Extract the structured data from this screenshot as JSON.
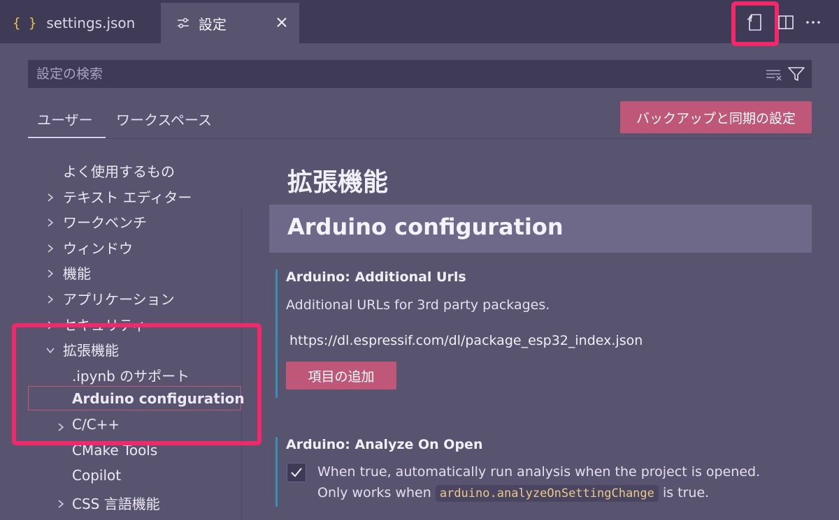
{
  "tabs": [
    {
      "label": "settings.json",
      "icon": "json-braces-icon",
      "icon_glyph": "{ }"
    },
    {
      "label": "設定",
      "icon": "settings-sliders-icon",
      "close_icon": "close-icon"
    }
  ],
  "toolbar": {
    "icons": [
      "open-settings-json-icon",
      "split-editor-icon",
      "more-actions-icon"
    ]
  },
  "search": {
    "placeholder": "設定の検索",
    "icons": [
      "clear-filter-icon",
      "filter-icon"
    ]
  },
  "scope_tabs": [
    "ユーザー",
    "ワークスペース"
  ],
  "sync_button": "バックアップと同期の設定",
  "toc": {
    "items": [
      {
        "label": "よく使用するもの",
        "chevron": "none"
      },
      {
        "label": "テキスト エディター",
        "chevron": "right"
      },
      {
        "label": "ワークベンチ",
        "chevron": "right"
      },
      {
        "label": "ウィンドウ",
        "chevron": "right"
      },
      {
        "label": "機能",
        "chevron": "right"
      },
      {
        "label": "アプリケーション",
        "chevron": "right"
      },
      {
        "label": "セキュリティ",
        "chevron": "right"
      },
      {
        "label": "拡張機能",
        "chevron": "down"
      },
      {
        "label": ".ipynb のサポート",
        "chevron": "none"
      },
      {
        "label": "Arduino configuration",
        "chevron": "none",
        "selected": true
      },
      {
        "label": "C/C++",
        "chevron": "right"
      },
      {
        "label": "CMake Tools",
        "chevron": "none"
      },
      {
        "label": "Copilot",
        "chevron": "none"
      },
      {
        "label": "CSS 言語機能",
        "chevron": "right"
      }
    ]
  },
  "content": {
    "heading": "拡張機能",
    "section_title": "Arduino configuration",
    "settings": [
      {
        "title": "Arduino: Additional Urls",
        "description": "Additional URLs for 3rd party packages.",
        "items": [
          "https://dl.espressif.com/dl/package_esp32_index.json"
        ],
        "add_button": "項目の追加"
      },
      {
        "title": "Arduino: Analyze On Open",
        "checked": true,
        "line1": "When true, automatically run analysis when the project is opened.",
        "line2_before": "Only works when",
        "code": "arduino.analyzeOnSettingChange",
        "line2_after": "is true."
      }
    ]
  },
  "colors": {
    "background": "#58536f",
    "tabbar": "#3f3a55",
    "button": "#bf5778",
    "highlight": "#f2286a",
    "accent": "#3a8fb5"
  }
}
